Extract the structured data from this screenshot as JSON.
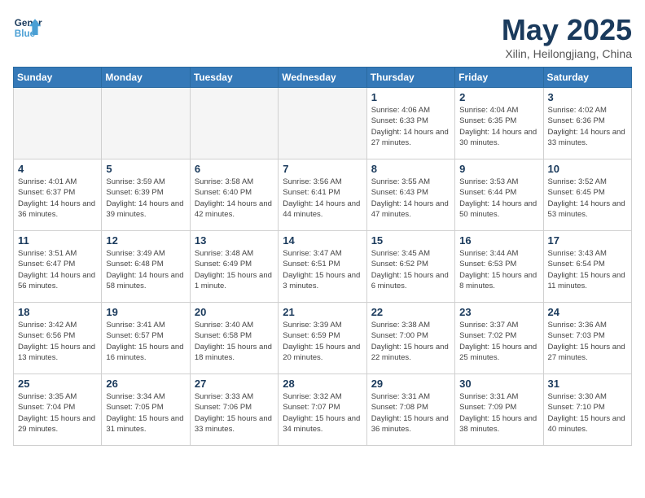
{
  "header": {
    "logo_line1": "General",
    "logo_line2": "Blue",
    "title": "May 2025",
    "subtitle": "Xilin, Heilongjiang, China"
  },
  "weekdays": [
    "Sunday",
    "Monday",
    "Tuesday",
    "Wednesday",
    "Thursday",
    "Friday",
    "Saturday"
  ],
  "weeks": [
    [
      {
        "day": "",
        "empty": true
      },
      {
        "day": "",
        "empty": true
      },
      {
        "day": "",
        "empty": true
      },
      {
        "day": "",
        "empty": true
      },
      {
        "day": "1",
        "sunrise": "4:06 AM",
        "sunset": "6:33 PM",
        "daylight": "14 hours and 27 minutes."
      },
      {
        "day": "2",
        "sunrise": "4:04 AM",
        "sunset": "6:35 PM",
        "daylight": "14 hours and 30 minutes."
      },
      {
        "day": "3",
        "sunrise": "4:02 AM",
        "sunset": "6:36 PM",
        "daylight": "14 hours and 33 minutes."
      }
    ],
    [
      {
        "day": "4",
        "sunrise": "4:01 AM",
        "sunset": "6:37 PM",
        "daylight": "14 hours and 36 minutes."
      },
      {
        "day": "5",
        "sunrise": "3:59 AM",
        "sunset": "6:39 PM",
        "daylight": "14 hours and 39 minutes."
      },
      {
        "day": "6",
        "sunrise": "3:58 AM",
        "sunset": "6:40 PM",
        "daylight": "14 hours and 42 minutes."
      },
      {
        "day": "7",
        "sunrise": "3:56 AM",
        "sunset": "6:41 PM",
        "daylight": "14 hours and 44 minutes."
      },
      {
        "day": "8",
        "sunrise": "3:55 AM",
        "sunset": "6:43 PM",
        "daylight": "14 hours and 47 minutes."
      },
      {
        "day": "9",
        "sunrise": "3:53 AM",
        "sunset": "6:44 PM",
        "daylight": "14 hours and 50 minutes."
      },
      {
        "day": "10",
        "sunrise": "3:52 AM",
        "sunset": "6:45 PM",
        "daylight": "14 hours and 53 minutes."
      }
    ],
    [
      {
        "day": "11",
        "sunrise": "3:51 AM",
        "sunset": "6:47 PM",
        "daylight": "14 hours and 56 minutes."
      },
      {
        "day": "12",
        "sunrise": "3:49 AM",
        "sunset": "6:48 PM",
        "daylight": "14 hours and 58 minutes."
      },
      {
        "day": "13",
        "sunrise": "3:48 AM",
        "sunset": "6:49 PM",
        "daylight": "15 hours and 1 minute."
      },
      {
        "day": "14",
        "sunrise": "3:47 AM",
        "sunset": "6:51 PM",
        "daylight": "15 hours and 3 minutes."
      },
      {
        "day": "15",
        "sunrise": "3:45 AM",
        "sunset": "6:52 PM",
        "daylight": "15 hours and 6 minutes."
      },
      {
        "day": "16",
        "sunrise": "3:44 AM",
        "sunset": "6:53 PM",
        "daylight": "15 hours and 8 minutes."
      },
      {
        "day": "17",
        "sunrise": "3:43 AM",
        "sunset": "6:54 PM",
        "daylight": "15 hours and 11 minutes."
      }
    ],
    [
      {
        "day": "18",
        "sunrise": "3:42 AM",
        "sunset": "6:56 PM",
        "daylight": "15 hours and 13 minutes."
      },
      {
        "day": "19",
        "sunrise": "3:41 AM",
        "sunset": "6:57 PM",
        "daylight": "15 hours and 16 minutes."
      },
      {
        "day": "20",
        "sunrise": "3:40 AM",
        "sunset": "6:58 PM",
        "daylight": "15 hours and 18 minutes."
      },
      {
        "day": "21",
        "sunrise": "3:39 AM",
        "sunset": "6:59 PM",
        "daylight": "15 hours and 20 minutes."
      },
      {
        "day": "22",
        "sunrise": "3:38 AM",
        "sunset": "7:00 PM",
        "daylight": "15 hours and 22 minutes."
      },
      {
        "day": "23",
        "sunrise": "3:37 AM",
        "sunset": "7:02 PM",
        "daylight": "15 hours and 25 minutes."
      },
      {
        "day": "24",
        "sunrise": "3:36 AM",
        "sunset": "7:03 PM",
        "daylight": "15 hours and 27 minutes."
      }
    ],
    [
      {
        "day": "25",
        "sunrise": "3:35 AM",
        "sunset": "7:04 PM",
        "daylight": "15 hours and 29 minutes."
      },
      {
        "day": "26",
        "sunrise": "3:34 AM",
        "sunset": "7:05 PM",
        "daylight": "15 hours and 31 minutes."
      },
      {
        "day": "27",
        "sunrise": "3:33 AM",
        "sunset": "7:06 PM",
        "daylight": "15 hours and 33 minutes."
      },
      {
        "day": "28",
        "sunrise": "3:32 AM",
        "sunset": "7:07 PM",
        "daylight": "15 hours and 34 minutes."
      },
      {
        "day": "29",
        "sunrise": "3:31 AM",
        "sunset": "7:08 PM",
        "daylight": "15 hours and 36 minutes."
      },
      {
        "day": "30",
        "sunrise": "3:31 AM",
        "sunset": "7:09 PM",
        "daylight": "15 hours and 38 minutes."
      },
      {
        "day": "31",
        "sunrise": "3:30 AM",
        "sunset": "7:10 PM",
        "daylight": "15 hours and 40 minutes."
      }
    ]
  ]
}
